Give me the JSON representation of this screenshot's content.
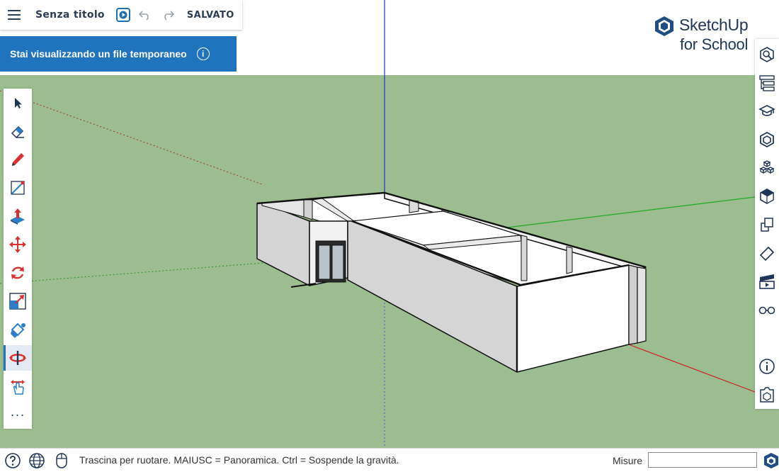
{
  "app": {
    "menu_icon": "hamburger-menu-icon",
    "document_title": "Senza titolo",
    "save_status": "SALVATO",
    "brand_name": "SketchUp",
    "brand_sub": "for School"
  },
  "banner": {
    "text": "Stai visualizzando un file temporaneo",
    "info_glyph": "i"
  },
  "left_toolbar": {
    "tools": [
      {
        "name": "select-tool",
        "icon": "arrow-cursor-icon"
      },
      {
        "name": "eraser-tool",
        "icon": "eraser-icon"
      },
      {
        "name": "pencil-tool",
        "icon": "pencil-icon"
      },
      {
        "name": "line-tool",
        "icon": "line-icon"
      },
      {
        "name": "push-pull-tool",
        "icon": "push-pull-icon"
      },
      {
        "name": "move-tool",
        "icon": "move-arrows-icon"
      },
      {
        "name": "rotate-tool",
        "icon": "rotate-icon"
      },
      {
        "name": "scale-tool",
        "icon": "scale-icon"
      },
      {
        "name": "paint-bucket-tool",
        "icon": "paint-bucket-icon"
      },
      {
        "name": "orbit-tool",
        "icon": "orbit-icon",
        "active": true
      },
      {
        "name": "pan-tool",
        "icon": "pan-hand-icon"
      },
      {
        "name": "more-tools",
        "icon": "more-dots-icon",
        "glyph": "···"
      }
    ]
  },
  "right_toolbar": {
    "panels": [
      "entity-info-icon",
      "outliner-icon",
      "instructor-icon",
      "components-icon",
      "materials-icon",
      "styles-icon",
      "tags-icon",
      "shadows-icon",
      "scenes-icon",
      "display-icon",
      "info-icon",
      "3d-warehouse-icon"
    ]
  },
  "status_bar": {
    "hint": "Trascina per ruotare. MAIUSC = Panoramica. Ctrl = Sospende la gravità.",
    "measurements_label": "Misure",
    "measurements_value": ""
  },
  "colors": {
    "sky": "#ffffff",
    "ground": "#9cbd8f",
    "accent": "#1f74bd",
    "active_tool": "#e3eaf3",
    "title_text": "#2b3c55"
  }
}
